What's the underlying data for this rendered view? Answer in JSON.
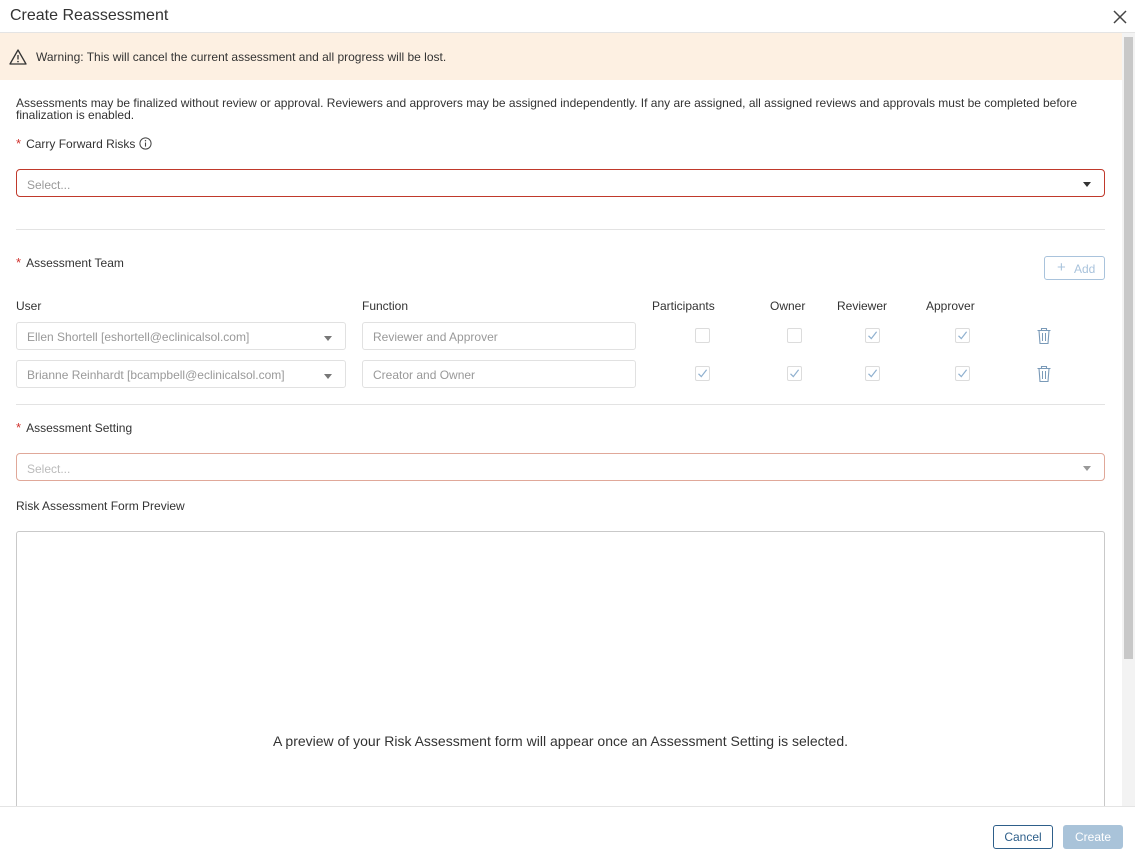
{
  "header": {
    "title": "Create Reassessment",
    "close_icon": "close-icon"
  },
  "warning": {
    "icon": "warning-triangle-icon",
    "text": "Warning: This will cancel the current assessment and all progress will be lost.",
    "background": "#fdf0e2"
  },
  "note": "Assessments may be finalized without review or approval. Reviewers and approvers may be assigned independently. If any are assigned, all assigned reviews and approvals must be completed before finalization is enabled.",
  "carry_forward": {
    "required": "*",
    "label": "Carry Forward Risks",
    "info_icon": "info-icon",
    "placeholder": "Select..."
  },
  "team": {
    "required": "*",
    "label": "Assessment Team",
    "add_icon": "plus-icon",
    "add_label": "Add",
    "columns": {
      "user": "User",
      "function": "Function",
      "participants": "Participants",
      "owner": "Owner",
      "reviewer": "Reviewer",
      "approver": "Approver"
    },
    "rows": [
      {
        "user": "Ellen Shortell [eshortell@eclinicalsol.com]",
        "function": "Reviewer and Approver",
        "participants": false,
        "owner": false,
        "reviewer": true,
        "approver": true,
        "delete_icon": "trash-icon"
      },
      {
        "user": "Brianne Reinhardt [bcampbell@eclinicalsol.com]",
        "function": "Creator and Owner",
        "participants": true,
        "owner": true,
        "reviewer": true,
        "approver": true,
        "delete_icon": "trash-icon"
      }
    ]
  },
  "setting": {
    "required": "*",
    "label": "Assessment Setting",
    "placeholder": "Select..."
  },
  "preview": {
    "label": "Risk Assessment Form Preview",
    "message": "A preview of your Risk Assessment form will appear once an Assessment Setting is selected."
  },
  "footer": {
    "cancel_label": "Cancel",
    "create_label": "Create"
  },
  "colors": {
    "accent": "#2e5f8a",
    "required": "#d0312d",
    "error_border": "#c0392b",
    "disabled_button": "#a9c3d9"
  }
}
